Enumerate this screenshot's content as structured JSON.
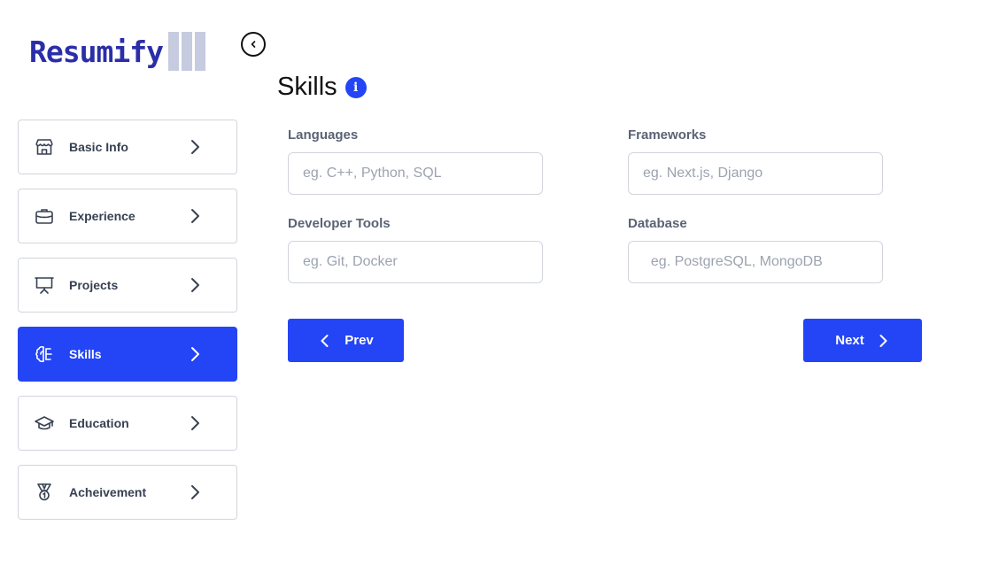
{
  "logo": {
    "text": "Resumify"
  },
  "sidebar": {
    "items": [
      {
        "label": "Basic Info",
        "icon": "store-icon",
        "active": false
      },
      {
        "label": "Experience",
        "icon": "briefcase-icon",
        "active": false
      },
      {
        "label": "Projects",
        "icon": "presentation-icon",
        "active": false
      },
      {
        "label": "Skills",
        "icon": "brain-icon",
        "active": true
      },
      {
        "label": "Education",
        "icon": "graduation-cap-icon",
        "active": false
      },
      {
        "label": "Acheivement",
        "icon": "medal-icon",
        "active": false
      }
    ]
  },
  "main": {
    "title": "Skills",
    "info_glyph": "i",
    "fields": {
      "languages": {
        "label": "Languages",
        "placeholder": "eg. C++, Python, SQL",
        "value": ""
      },
      "frameworks": {
        "label": "Frameworks",
        "placeholder": "eg. Next.js, Django",
        "value": ""
      },
      "developer_tools": {
        "label": "Developer Tools",
        "placeholder": "eg. Git, Docker",
        "value": ""
      },
      "database": {
        "label": "Database",
        "placeholder": "  eg. PostgreSQL, MongoDB",
        "value": ""
      }
    },
    "prev_label": "Prev",
    "next_label": "Next"
  },
  "colors": {
    "accent": "#2445f5",
    "logo": "#2b2ea8",
    "border": "#d1d5db",
    "muted_text": "#5b6375"
  }
}
